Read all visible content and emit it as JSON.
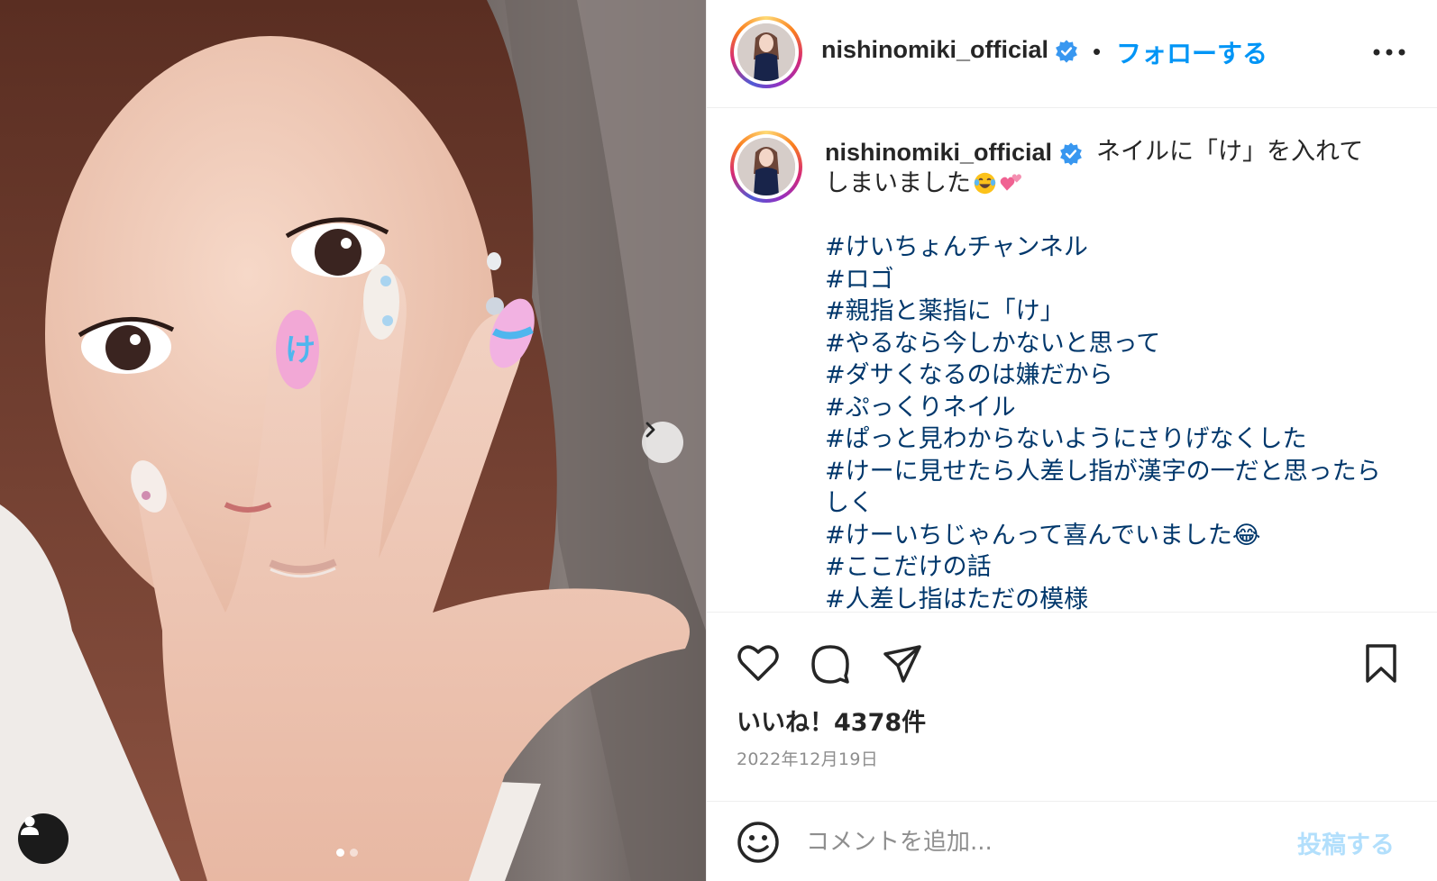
{
  "post": {
    "username": "nishinomiki_official",
    "separator": "•",
    "follow_label": "フォローする",
    "more_icon": "more-horizontal-icon"
  },
  "caption": {
    "username": "nishinomiki_official",
    "text_line1": "ネイルに「け」を入れて",
    "text_line2": "しまいました",
    "emojis": [
      "face-with-tears-of-joy",
      "two-hearts"
    ],
    "hashtags": [
      "#けいちょんチャンネル",
      "#ロゴ",
      "#親指と薬指に「け」",
      "#やるなら今しかないと思って",
      "#ダサくなるのは嫌だから",
      "#ぷっくりネイル",
      "#ぱっと見わからないようにさりげなくした",
      "#けーに見せたら人差し指が漢字の一だと思ったらしく",
      "#けーいちじゃんって喜んでいました😂",
      "#ここだけの話",
      "#人差し指はただの模様"
    ]
  },
  "actions": {
    "icons": [
      "heart-icon",
      "comment-icon",
      "share-icon",
      "bookmark-icon"
    ],
    "likes": "いいね！4378件",
    "date": "2022年12月19日"
  },
  "comment": {
    "placeholder": "コメントを追加...",
    "post_label": "投稿する",
    "emoji_icon": "smiley-icon"
  },
  "media": {
    "carousel_count": 2,
    "carousel_active": 1
  },
  "colors": {
    "accent": "#0095f6",
    "hashtag": "#00376b",
    "muted": "#8e8e8e",
    "post_disabled": "#b2dffc"
  }
}
